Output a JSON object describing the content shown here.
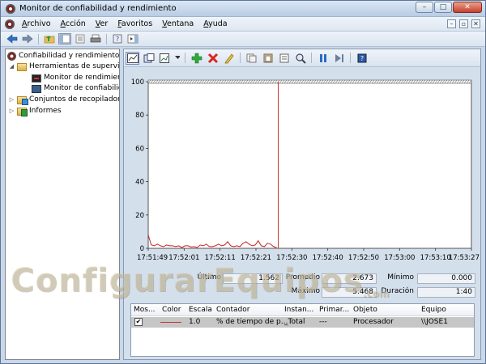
{
  "window": {
    "title": "Monitor de confiabilidad y rendimiento",
    "caption_buttons": [
      "–",
      "□",
      "✕"
    ]
  },
  "menu": {
    "items": [
      "Archivo",
      "Acción",
      "Ver",
      "Favoritos",
      "Ventana",
      "Ayuda"
    ],
    "mdi_buttons": [
      "–",
      "▫",
      "✕"
    ]
  },
  "tree": {
    "root": "Confiabilidad y rendimiento",
    "tools": "Herramientas de supervisión",
    "perf_monitor": "Monitor de rendimiento",
    "rel_monitor": "Monitor de confiabilidad",
    "collector_sets": "Conjuntos de recopiladores",
    "reports": "Informes"
  },
  "chart_data": {
    "type": "line",
    "ylim": [
      0,
      100
    ],
    "y_ticks": [
      0,
      20,
      40,
      60,
      80,
      100
    ],
    "x_ticks": [
      "17:51:49",
      "17:52:01",
      "17:52:11",
      "17:52:21",
      "17:52:30",
      "17:52:40",
      "17:52:50",
      "17:53:00",
      "17:53:10",
      "17:53:27"
    ],
    "series": [
      {
        "color": "#cc2222",
        "values": [
          8,
          2,
          1.5,
          2.5,
          1.5,
          1,
          2,
          1.5,
          1.5,
          1,
          1.5,
          0.5,
          1.5,
          1.5,
          0.8,
          1,
          0.5,
          2,
          1.5,
          2.5,
          1,
          1,
          1.5,
          2.5,
          1.5,
          2,
          4,
          1.5,
          1,
          1.5,
          1,
          3,
          4,
          2.5,
          1.5,
          2,
          4.5,
          1.5,
          1,
          3,
          2.5,
          1,
          0.5
        ]
      }
    ],
    "cursor_at": "17:52:27"
  },
  "stats": {
    "last_label": "Último",
    "last_value": "1.562",
    "avg_label": "Promedio",
    "avg_value": "2.673",
    "min_label": "Mínimo",
    "min_value": "0.000",
    "max_label": "Máximo",
    "max_value": "5.468",
    "dur_label": "Duración",
    "dur_value": "1:40"
  },
  "counters": {
    "headers": [
      "Mos...",
      "Color",
      "Escala",
      "Contador",
      "Instan...",
      "Primar...",
      "Objeto",
      "Equipo"
    ],
    "row": {
      "show": "✔",
      "scale": "1.0",
      "counter": "% de tiempo de p...",
      "instance": "_Total",
      "primary": "---",
      "object": "Procesador",
      "computer": "\\\\JOSE1"
    }
  },
  "watermark": {
    "text": "ConfigurarEquipos",
    "suffix": ".com"
  },
  "colors": {
    "series": "#cc2222",
    "cursor": "#cc3333"
  }
}
